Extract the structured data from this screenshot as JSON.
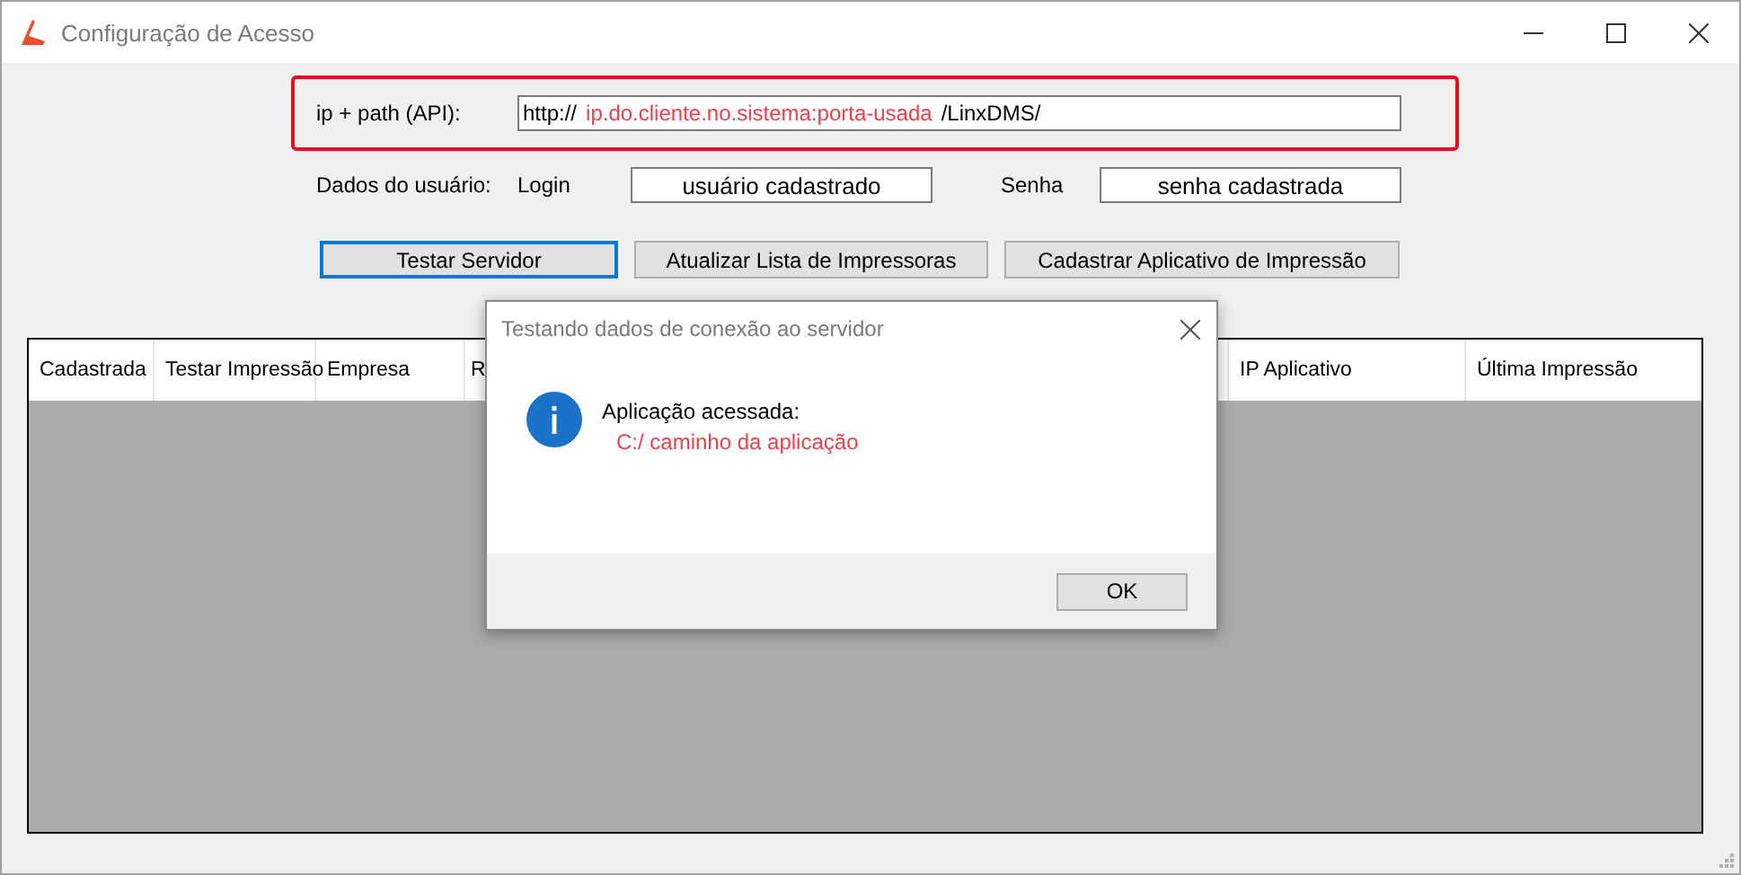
{
  "window": {
    "title": "Configuração de Acesso",
    "controls": [
      {
        "kind": "minimize"
      },
      {
        "kind": "maximize"
      },
      {
        "kind": "close"
      }
    ]
  },
  "api": {
    "label": "ip + path (API):",
    "value_parts": [
      {
        "text": "http://",
        "highlight": false
      },
      {
        "text": "ip.do.cliente.no.sistema:porta-usada",
        "highlight": true
      },
      {
        "text": "/LinxDMS/",
        "highlight": false
      }
    ],
    "outlined": true
  },
  "user": {
    "label": "Dados do usuário:",
    "login_label": "Login",
    "login_value": "usuário cadastrado",
    "password_label": "Senha",
    "password_value": "senha cadastrada"
  },
  "buttons": [
    {
      "label": "Testar Servidor",
      "focused": true
    },
    {
      "label": "Atualizar Lista de Impressoras",
      "focused": false
    },
    {
      "label": "Cadastrar Aplicativo de Impressão",
      "focused": false
    }
  ],
  "table": {
    "columns": [
      "Cadastrada",
      "Testar Impressão",
      "Empresa",
      "R",
      "IP Aplicativo",
      "Última Impressão"
    ]
  },
  "dialog": {
    "title": "Testando dados de conexão ao servidor",
    "lines": [
      {
        "text": "Aplicação acessada:",
        "highlight": false
      },
      {
        "text": "C:/ caminho da aplicação",
        "highlight": true
      }
    ],
    "button": "OK"
  }
}
